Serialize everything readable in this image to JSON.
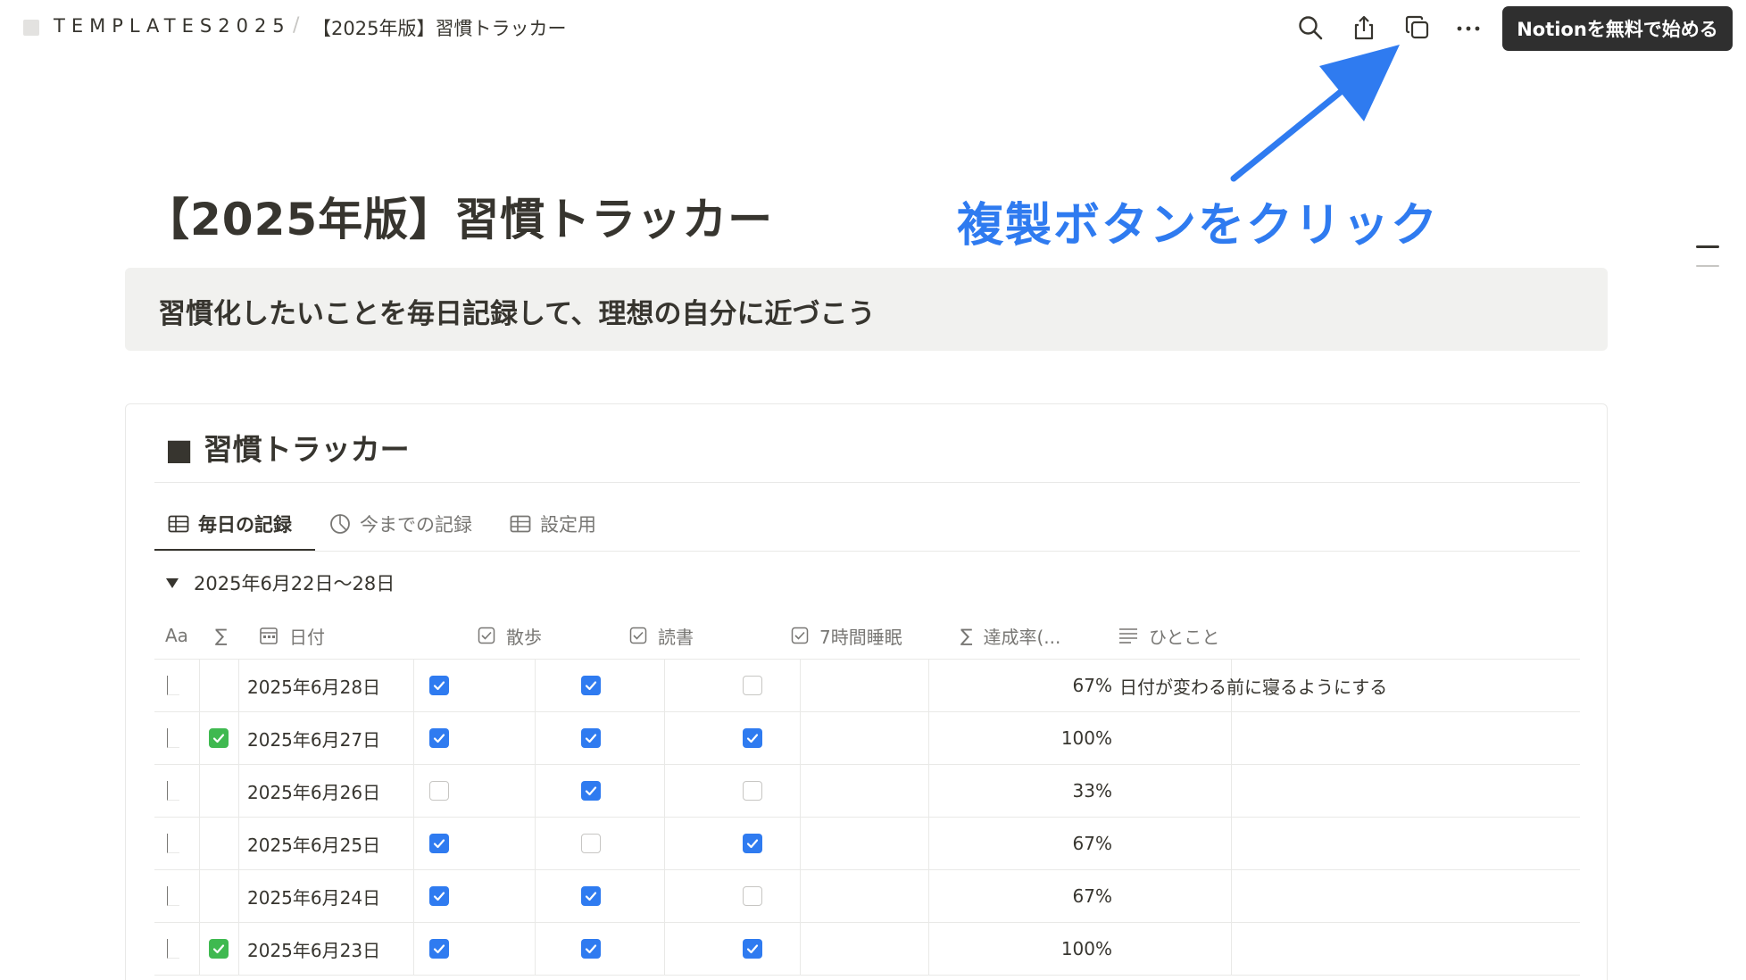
{
  "topbar": {
    "workspace": "TEMPLATES2025",
    "separator": "/",
    "page": "【2025年版】習慣トラッカー",
    "cta": "Notionを無料で始める",
    "icons": [
      "search-icon",
      "share-icon",
      "duplicate-icon",
      "more-icon"
    ]
  },
  "page": {
    "title": "【2025年版】習慣トラッカー",
    "annotation": "複製ボタンをクリック",
    "callout": "習慣化したいことを毎日記録して、理想の自分に近づこう"
  },
  "database": {
    "heading": "■ 習慣トラッカー",
    "tabs": [
      {
        "label": "毎日の記録",
        "icon": "table-icon"
      },
      {
        "label": "今までの記録",
        "icon": "chart-icon"
      },
      {
        "label": "設定用",
        "icon": "table-icon"
      }
    ],
    "group": "2025年6月22日〜28日",
    "columns": {
      "name": "Aa",
      "formula": "∑",
      "date": "日付",
      "walk": "散歩",
      "reading": "読書",
      "sleep": "7時間睡眠",
      "rate": "達成率(...",
      "note": "ひとこと"
    },
    "rows": [
      {
        "date": "2025年6月28日",
        "done": false,
        "walk": true,
        "reading": true,
        "sleep": false,
        "rate": "67%",
        "note": "日付が変わる前に寝るようにする"
      },
      {
        "date": "2025年6月27日",
        "done": true,
        "walk": true,
        "reading": true,
        "sleep": true,
        "rate": "100%",
        "note": ""
      },
      {
        "date": "2025年6月26日",
        "done": false,
        "walk": false,
        "reading": true,
        "sleep": false,
        "rate": "33%",
        "note": ""
      },
      {
        "date": "2025年6月25日",
        "done": false,
        "walk": true,
        "reading": false,
        "sleep": true,
        "rate": "67%",
        "note": ""
      },
      {
        "date": "2025年6月24日",
        "done": false,
        "walk": true,
        "reading": true,
        "sleep": false,
        "rate": "67%",
        "note": ""
      },
      {
        "date": "2025年6月23日",
        "done": true,
        "walk": true,
        "reading": true,
        "sleep": true,
        "rate": "100%",
        "note": ""
      }
    ]
  },
  "colors": {
    "accent": "#2f7bf0",
    "text": "#37352f",
    "muted": "#787774",
    "callout_bg": "#f1f1ef",
    "cta_bg": "#2f2f2f",
    "check_green": "#3fb950"
  }
}
